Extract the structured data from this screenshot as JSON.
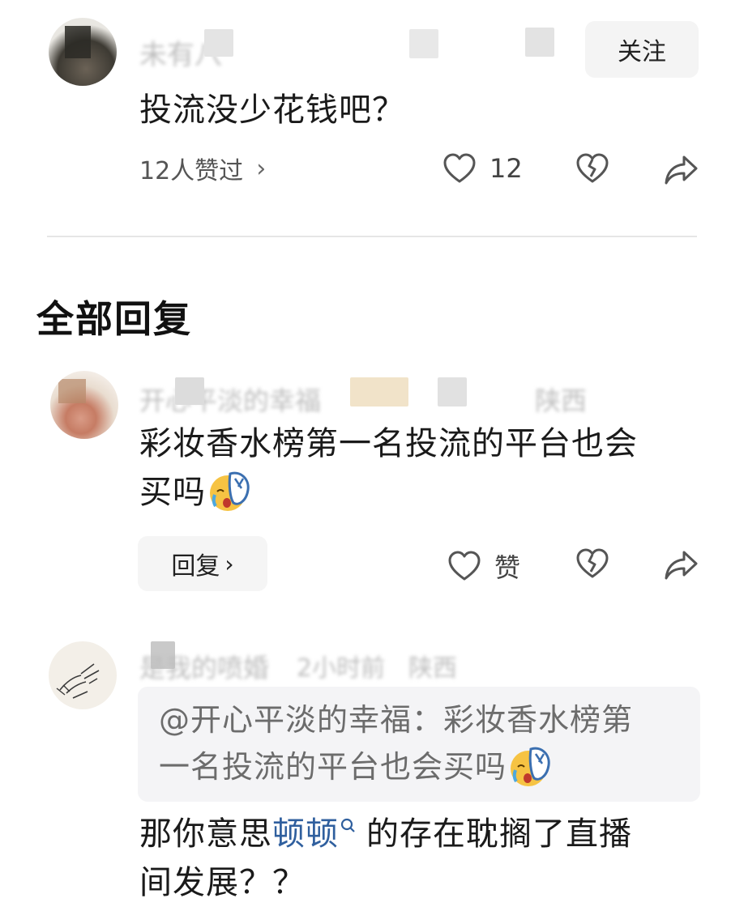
{
  "main_comment": {
    "username_obscured": "未有八",
    "follow_label": "关注",
    "text": "投流没少花钱吧？",
    "likes_summary": "12人赞过",
    "likes_chevron": "›",
    "like_count": "12"
  },
  "section_title": "全部回复",
  "replies": [
    {
      "username_obscured": "开心平淡的幸福",
      "meta_obscured": "陕西",
      "text_line1": "彩妆香水榜第一名投流的平台也会",
      "text_line2": "买吗",
      "reply_label": "回复",
      "reply_chevron": "›",
      "like_label": "赞"
    },
    {
      "username_obscured": "是我的喷婚",
      "time_obscured": "2小时前",
      "location_obscured": "陕西",
      "quote_line1": "@开心平淡的幸福：彩妆香水榜第",
      "quote_line2": "一名投流的平台也会买吗",
      "text_part1": "那你意思",
      "text_link": "顿顿",
      "text_part2": "的存在耽搁了直播",
      "text_line2": "间发展？？"
    }
  ],
  "icons": {
    "like": "heart-icon",
    "dislike": "broken-heart-icon",
    "share": "share-arrow-icon",
    "search_link": "search-icon",
    "emoji": "crying-sandal-emoji"
  },
  "colors": {
    "link": "#2f5f9e",
    "muted_text": "#555555",
    "button_bg": "#f4f4f4"
  }
}
